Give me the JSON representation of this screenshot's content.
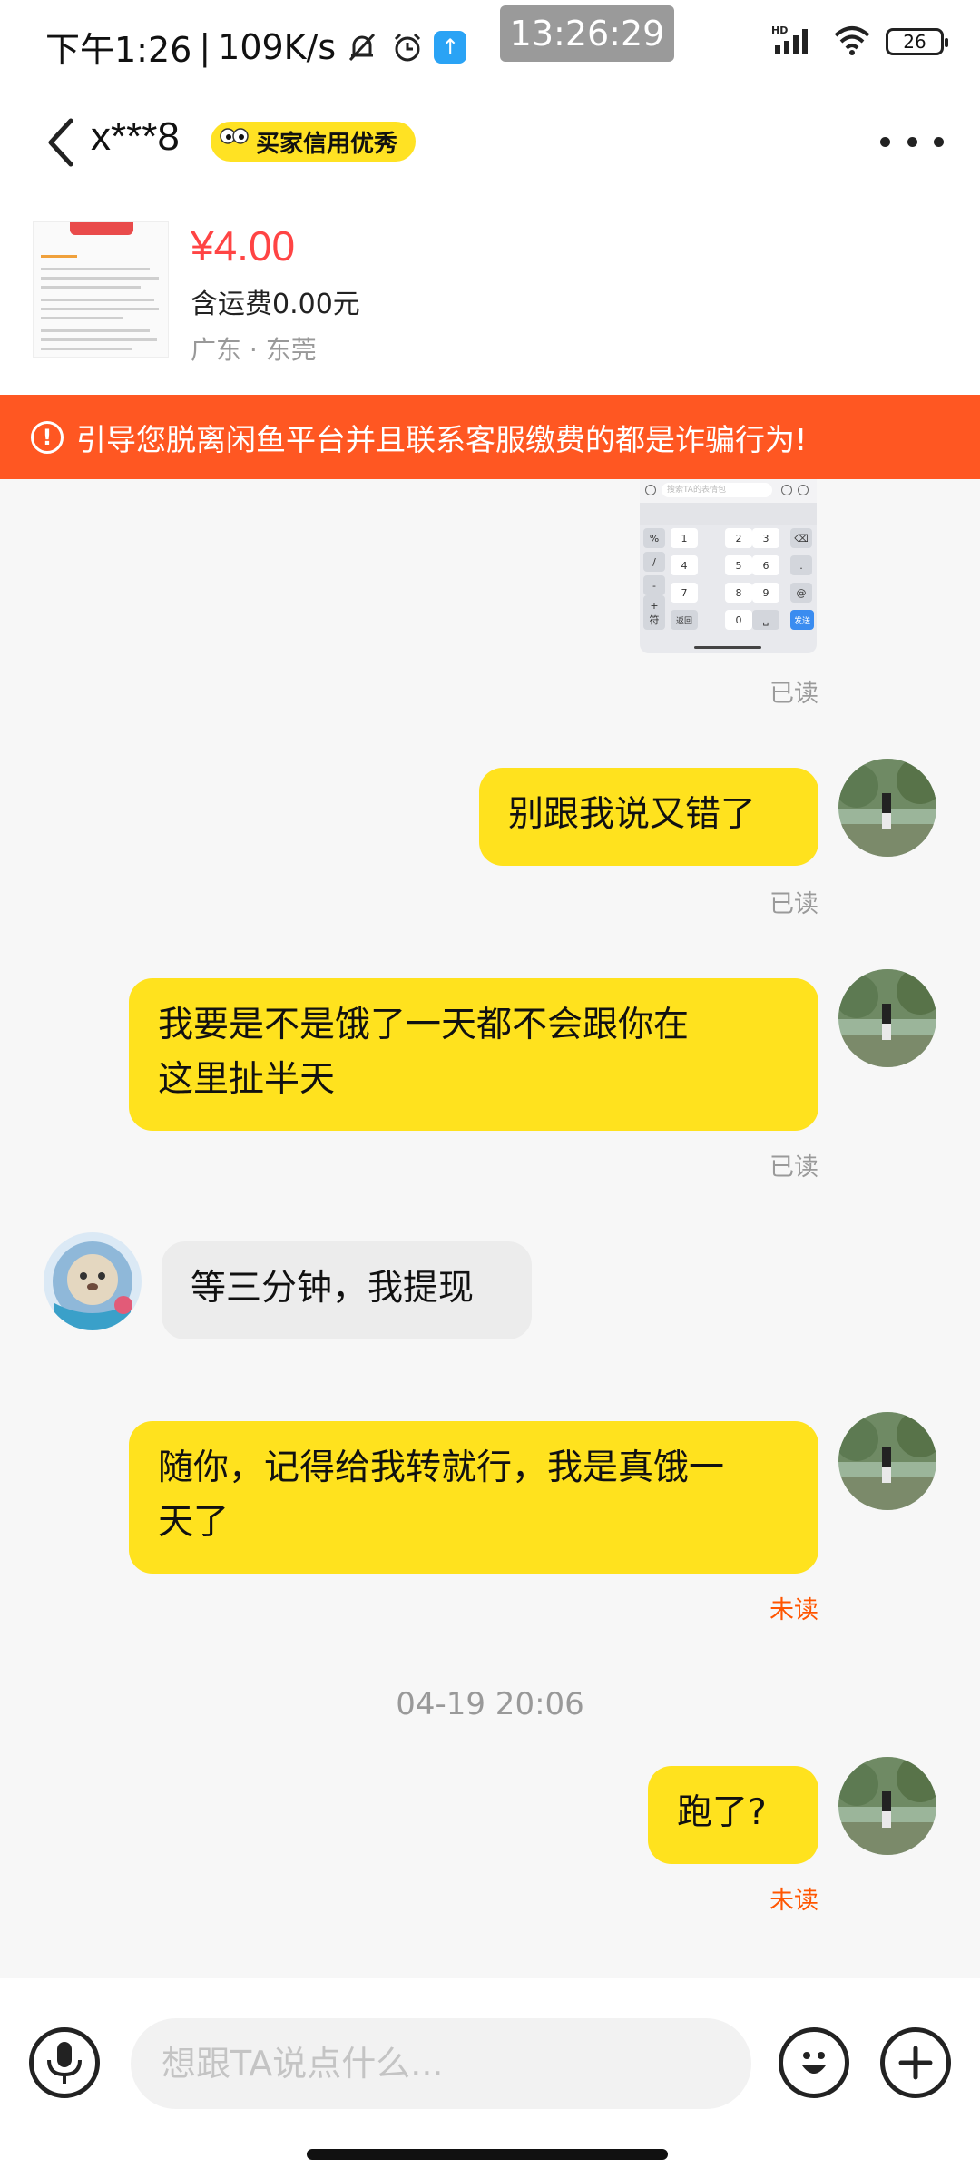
{
  "status_bar": {
    "time_label": "下午1:26",
    "separator": "|",
    "net_speed": "109K/s",
    "clock_overlay": "13:26:29",
    "network_type": "HD",
    "battery_level": "26"
  },
  "header": {
    "peer_name": "x***8",
    "credit_badge": "买家信用优秀"
  },
  "product": {
    "price": "¥4.00",
    "shipping": "含运费0.00元",
    "location": "广东 · 东莞"
  },
  "warning": {
    "text": "引导您脱离闲鱼平台并且联系客服缴费的都是诈骗行为!"
  },
  "messages": [
    {
      "direction": "out",
      "type": "image",
      "status": "已读"
    },
    {
      "direction": "out",
      "type": "text",
      "text": "别跟我说又错了",
      "status": "已读"
    },
    {
      "direction": "out",
      "type": "text",
      "line1": "我要是不是饿了一天都不会跟你在",
      "line2": "这里扯半天",
      "status": "已读"
    },
    {
      "direction": "in",
      "type": "text",
      "text": "等三分钟，我提现"
    },
    {
      "direction": "out",
      "type": "text",
      "line1": "随你，记得给我转就行，我是真饿一",
      "line2": "天了",
      "status": "未读"
    },
    {
      "direction": "out",
      "type": "text",
      "text": "跑了?",
      "status": "未读"
    }
  ],
  "timestamp": "04-19 20:06",
  "keyboard_image": {
    "search_hint": "搜索TA的表情包",
    "keys": [
      "%",
      "1",
      "2",
      "3",
      "/",
      "4",
      "5",
      "6",
      ".",
      "-",
      "+",
      "7",
      "8",
      "9",
      "@",
      "符",
      "返回",
      "0",
      "发送"
    ]
  },
  "input": {
    "placeholder": "想跟TA说点什么..."
  },
  "icons": {
    "back": "chevron-left-icon",
    "more": "more-dots-icon",
    "voice": "microphone-icon",
    "emoji": "emoji-icon",
    "add": "plus-icon",
    "warning": "exclamation-circle-icon"
  },
  "colors": {
    "outgoing_bubble": "#ffe21e",
    "incoming_bubble": "#ececec",
    "warning_banner": "#ff5722",
    "price": "#ff4444",
    "unread": "#ff5500",
    "credit_badge": "#ffe223"
  }
}
